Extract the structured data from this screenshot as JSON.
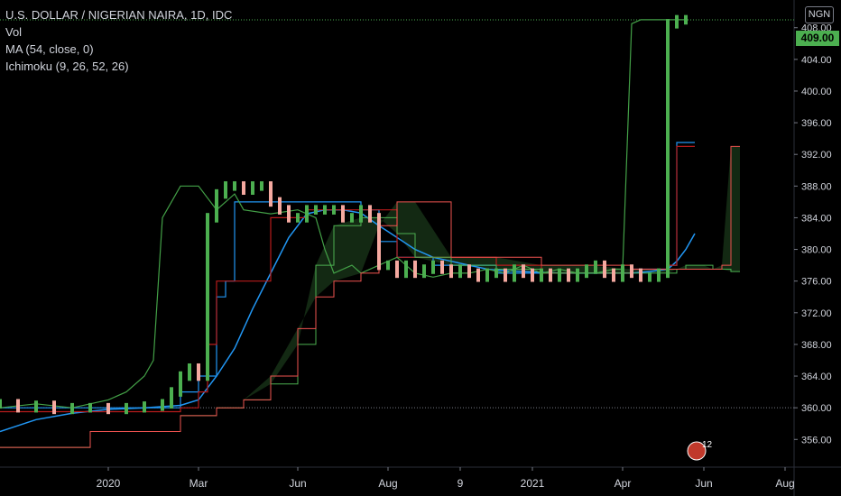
{
  "legend": {
    "title": "U.S. DOLLAR / NIGERIAN NAIRA, 1D, IDC",
    "vol": "Vol",
    "ma": "MA (54, close, 0)",
    "ichimoku": "Ichimoku (9, 26, 52, 26)"
  },
  "currency_badge": "NGN",
  "last_price_label": "409.00",
  "event_marker_label": "12",
  "colors": {
    "background": "#000000",
    "axis_text": "#d1d4dc",
    "candle_up": "#4caf50",
    "candle_down": "#f5a9a0",
    "ma": "#2196f3",
    "conversion": "#2196f3",
    "base": "#b71c1c",
    "lagging": "#43a047",
    "lead_a": "#4caf50",
    "lead_b": "#ef5350",
    "cloud": "#1b3a1b",
    "price_tag": "#4caf50"
  },
  "chart_data": {
    "type": "line",
    "title": "U.S. DOLLAR / NIGERIAN NAIRA, 1D, IDC",
    "ylim": [
      352.5,
      411.5
    ],
    "y_ticks": [
      "356.00",
      "360.00",
      "364.00",
      "368.00",
      "372.00",
      "376.00",
      "380.00",
      "384.00",
      "388.00",
      "392.00",
      "396.00",
      "400.00",
      "404.00",
      "408.00"
    ],
    "y_tick_values": [
      356,
      360,
      364,
      368,
      372,
      376,
      380,
      384,
      388,
      392,
      396,
      400,
      404,
      408
    ],
    "x_ticks": [
      "2020",
      "Mar",
      "Jun",
      "Aug",
      "9",
      "2021",
      "Apr",
      "Jun",
      "Aug"
    ],
    "x_tick_index": [
      12,
      22,
      33,
      43,
      51,
      59,
      69,
      78,
      87
    ],
    "x_index_range": [
      0,
      88
    ],
    "last_price": 409.0,
    "series": [
      {
        "name": "Close",
        "x": [
          0,
          2,
          4,
          6,
          8,
          10,
          12,
          14,
          16,
          18,
          19,
          20,
          21,
          22,
          23,
          24,
          25,
          26,
          27,
          28,
          29,
          30,
          31,
          32,
          33,
          34,
          35,
          36,
          37,
          38,
          39,
          40,
          41,
          42,
          43,
          44,
          45,
          46,
          47,
          48,
          49,
          50,
          51,
          52,
          53,
          54,
          55,
          56,
          57,
          58,
          59,
          60,
          61,
          62,
          63,
          64,
          65,
          66,
          67,
          68,
          69,
          70,
          71,
          72,
          73,
          74,
          75,
          76
        ],
        "values": [
          360.5,
          360,
          360.3,
          359.8,
          360,
          360,
          359.8,
          360,
          360.2,
          360.5,
          362,
          364,
          365,
          364,
          384,
          387,
          388,
          388,
          387.5,
          388,
          388,
          386,
          385,
          384,
          384,
          385,
          385,
          385,
          385,
          384,
          384,
          385,
          384,
          378,
          378,
          377,
          378,
          377,
          377.5,
          378,
          377.5,
          377,
          377.5,
          377,
          376.5,
          377,
          377,
          376.5,
          377.5,
          377,
          376.5,
          377,
          376.5,
          377,
          376.5,
          377,
          377.5,
          378,
          377,
          376.5,
          377.5,
          377,
          376.5,
          376.5,
          377,
          408.5,
          409,
          409
        ]
      },
      {
        "name": "MA",
        "x": [
          0,
          4,
          8,
          12,
          16,
          20,
          22,
          24,
          26,
          28,
          30,
          32,
          34,
          36,
          38,
          40,
          42,
          44,
          46,
          48,
          50,
          52,
          54,
          56,
          58,
          60,
          62,
          64,
          66,
          68,
          70,
          72,
          74,
          75,
          76,
          77
        ],
        "values": [
          357,
          358.5,
          359.3,
          359.8,
          360,
          360.3,
          361,
          364,
          367.5,
          372.5,
          377,
          381.5,
          384.5,
          385,
          385,
          384.6,
          383,
          381.5,
          380,
          379,
          378.5,
          378,
          377.5,
          377.3,
          377.2,
          377.1,
          377,
          377,
          377,
          377,
          377,
          377.2,
          377.5,
          378.5,
          380,
          382
        ]
      },
      {
        "name": "Conversion",
        "x": [
          0,
          6,
          12,
          18,
          20,
          22,
          24,
          25,
          26,
          27,
          28,
          30,
          33,
          36,
          39,
          40,
          42,
          44,
          46,
          48,
          50,
          55,
          60,
          65,
          70,
          72,
          74,
          75,
          76,
          77
        ],
        "values": [
          360,
          360,
          360,
          360,
          362,
          364,
          374,
          376,
          386,
          386,
          386,
          386,
          386,
          386,
          386,
          385,
          381,
          379,
          379,
          378,
          378,
          377,
          377,
          377,
          377.5,
          377.5,
          378,
          393.5,
          393.5,
          393.5
        ]
      },
      {
        "name": "Base Line",
        "x": [
          0,
          10,
          20,
          22,
          23,
          24,
          26,
          27,
          30,
          32,
          34,
          36,
          40,
          44,
          50,
          55,
          60,
          66,
          70,
          72,
          74,
          75,
          76,
          77
        ],
        "values": [
          359.5,
          359.5,
          360,
          362,
          368,
          376,
          376,
          376,
          384,
          384,
          385,
          385,
          385,
          379,
          379,
          378,
          377,
          377,
          377.5,
          377.5,
          378,
          393,
          393,
          393
        ]
      },
      {
        "name": "Lagging Span",
        "x": [
          0,
          4,
          8,
          12,
          14,
          16,
          17,
          18,
          19,
          20,
          22,
          24,
          26,
          27,
          30,
          33,
          35,
          36,
          37,
          39,
          40,
          42,
          44,
          46,
          48,
          50,
          52,
          54,
          56,
          58,
          60,
          62,
          64,
          66,
          68,
          69,
          70,
          71,
          72,
          73,
          74,
          75,
          76
        ],
        "values": [
          360,
          360.5,
          360,
          361,
          362,
          364,
          366,
          384,
          386,
          388,
          388,
          385,
          387,
          385,
          384.5,
          385,
          384,
          380,
          377,
          378,
          377,
          378,
          379,
          377,
          376.5,
          377,
          377,
          377.5,
          377,
          378,
          377,
          377.5,
          377,
          377,
          377.5,
          377.5,
          408.5,
          409,
          409,
          409,
          409,
          409,
          409
        ]
      },
      {
        "name": "Lead 1",
        "x": [
          0,
          10,
          20,
          24,
          27,
          30,
          33,
          35,
          37,
          40,
          42,
          44,
          46,
          50,
          55,
          60,
          65,
          70,
          74,
          75,
          76,
          77,
          78,
          79,
          80,
          81,
          82
        ],
        "values": [
          355,
          357,
          359,
          360,
          361,
          363,
          368,
          378,
          383,
          384,
          384,
          382,
          379,
          378,
          377.5,
          377,
          377,
          377,
          377,
          377.5,
          378,
          378,
          378,
          377.5,
          377.5,
          377.2,
          377.2
        ]
      },
      {
        "name": "Lead 2",
        "x": [
          0,
          10,
          20,
          24,
          27,
          30,
          33,
          35,
          37,
          40,
          42,
          44,
          46,
          50,
          55,
          60,
          65,
          70,
          74,
          75,
          76,
          77,
          78,
          79,
          80,
          81,
          82
        ],
        "values": [
          355,
          357,
          359,
          360,
          361,
          364,
          370,
          374,
          376,
          377,
          383,
          386,
          386,
          379,
          379,
          378,
          378,
          377.5,
          377.5,
          377.5,
          377.5,
          377.5,
          377.5,
          377.5,
          378,
          393,
          393
        ]
      }
    ]
  }
}
